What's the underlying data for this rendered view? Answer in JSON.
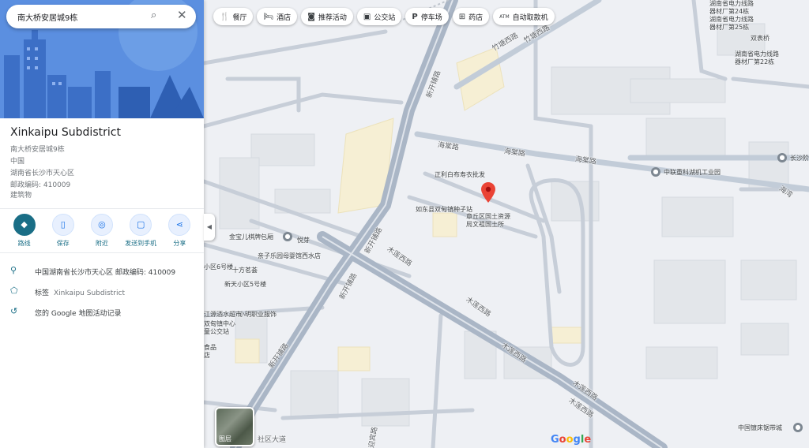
{
  "search": {
    "query": "南大桥安居城9栋"
  },
  "place": {
    "title": "Xinkaipu Subdistrict",
    "address_lines": [
      "南大桥安居城9栋",
      "中国",
      "湖南省长沙市天心区",
      "邮政编码: 410009",
      "建筑物"
    ]
  },
  "actions": [
    {
      "label": "路线",
      "icon": "directions-icon"
    },
    {
      "label": "保存",
      "icon": "bookmark-icon"
    },
    {
      "label": "附近",
      "icon": "nearby-icon"
    },
    {
      "label": "发送到手机",
      "icon": "send-to-phone-icon"
    },
    {
      "label": "分享",
      "icon": "share-icon"
    }
  ],
  "info": {
    "address": "中国湖南省长沙市天心区 邮政编码: 410009",
    "label_prefix": "标签",
    "label_value": "Xinkaipu Subdistrict",
    "history": "您的 Google 地图活动记录"
  },
  "chips": [
    {
      "label": "餐厅",
      "icon": "restaurant-icon"
    },
    {
      "label": "酒店",
      "icon": "hotel-icon"
    },
    {
      "label": "推荐活动",
      "icon": "camera-icon"
    },
    {
      "label": "公交站",
      "icon": "bus-icon"
    },
    {
      "label": "停车场",
      "icon": "parking-icon"
    },
    {
      "label": "药店",
      "icon": "pharmacy-icon"
    },
    {
      "label": "自动取款机",
      "icon": "atm-icon"
    }
  ],
  "map": {
    "road_labels": {
      "zhuzhi1": "竹塘西路",
      "zhuzhi2": "竹塘西路",
      "xinkai1": "新开铺路",
      "xinkai2": "新开铺路",
      "xinkai3": "新开铺路",
      "xinkai4": "新开铺路",
      "haitang1": "海棠路",
      "haitang2": "海棠路",
      "haitang3": "海棠路",
      "mumu1": "木莲西路",
      "mumu2": "木莲西路",
      "mumu3": "木莲西路",
      "mumu4": "木莲西路",
      "mumu5": "木莲西路",
      "shequ": "社区大道",
      "yingbin": "迎宾路",
      "haiwan": "海湾"
    },
    "pois": {
      "p1": "正利白布寿衣批发",
      "p2": "如东县双甸镇种子站",
      "p3": "章丘区国土资源\n局文祖国土所",
      "p4": "金宝儿棋牌包厢",
      "p5": "悦芽",
      "p6": "亲子乐园母婴馆西水店",
      "p7": "十方茗荟",
      "p8": "新天小区5号楼",
      "p9": "小区6号楼",
      "p10": "小明职业服饰",
      "p11": "江源酒水超市",
      "p12": "双甸镇中心\n童公交站",
      "p13": "食品\n店",
      "p14": "中联重科湖机工业园",
      "p15": "湖南省电力线路\n器材厂第24栋",
      "p16": "湖南省电力线路\n器材厂第25栋",
      "p17": "双表桥",
      "p18": "湖南省电力线路\n器材厂第22栋",
      "p19": "长沙阶",
      "p20": "中国镀床锯带城"
    },
    "layers_label": "图层",
    "google_logo": "Google"
  },
  "colors": {
    "accent": "#1a6e86",
    "pin": "#ea4335",
    "road": "#aab6c6",
    "hero": "#5b8fe0"
  }
}
